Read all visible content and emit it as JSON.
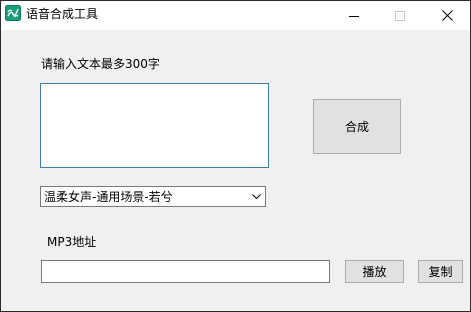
{
  "window": {
    "title": "语音合成工具",
    "icon": "app-logo-icon",
    "controls": [
      "minimize-icon",
      "maximize-icon",
      "close-icon"
    ]
  },
  "form": {
    "input_label": "请输入文本最多300字",
    "text_value": "",
    "synthesize_label": "合成",
    "voice_selected": "温柔女声-通用场景-若兮",
    "mp3_label": "MP3地址",
    "mp3_value": "",
    "play_label": "播放",
    "copy_label": "复制"
  },
  "colors": {
    "background": "#f0f0f0",
    "button": "#e1e1e1",
    "focus_border": "#3d7bad",
    "icon_green": "#1a9e7a"
  }
}
